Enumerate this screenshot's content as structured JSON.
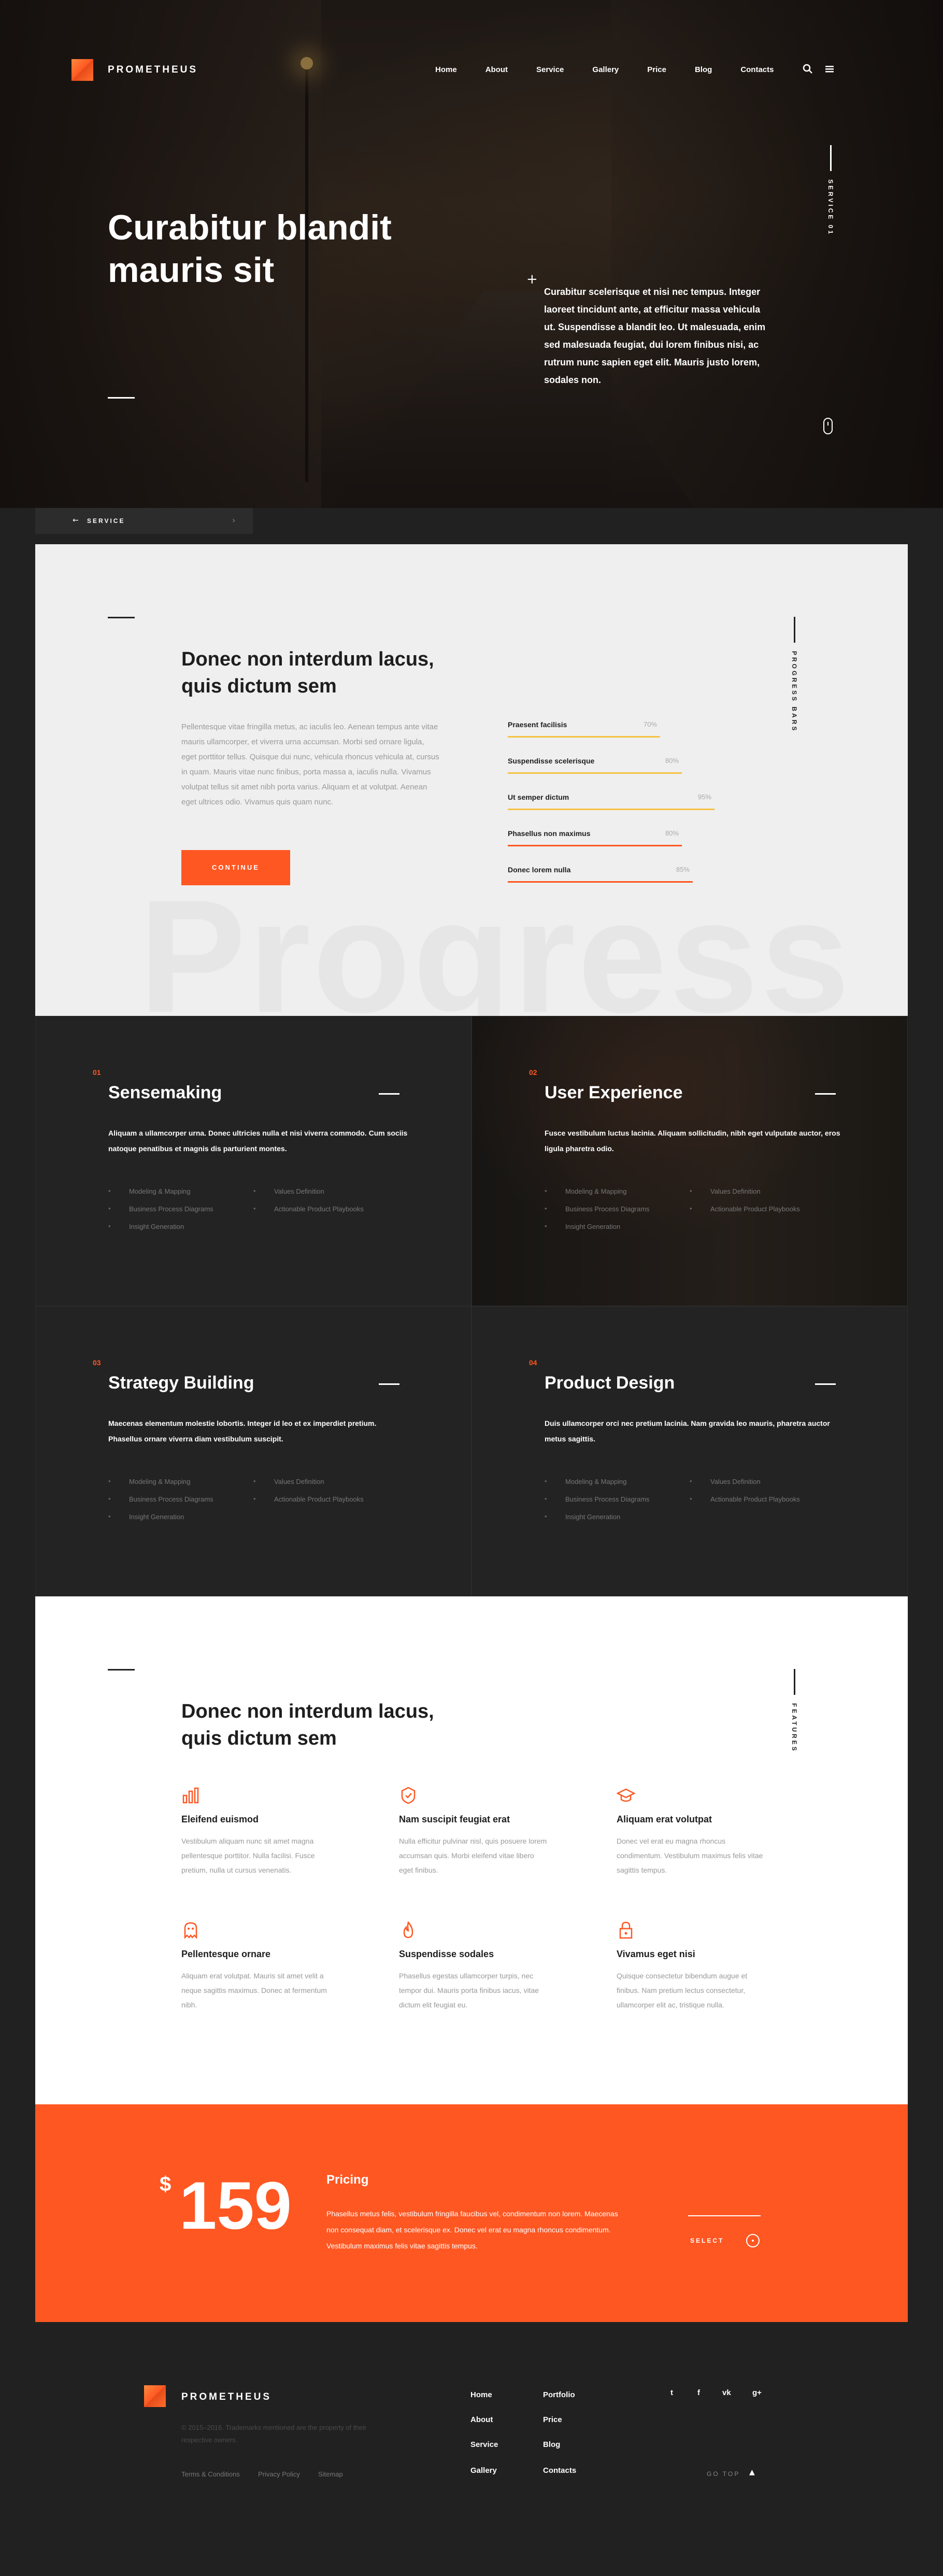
{
  "brand": {
    "name": "PROMETHEUS",
    "accent": "#ff5722"
  },
  "nav": {
    "links": [
      "Home",
      "About",
      "Service",
      "Gallery",
      "Price",
      "Blog",
      "Contacts"
    ],
    "search_icon": "search-icon",
    "menu_icon": "menu-icon"
  },
  "hero": {
    "title": "Curabitur blandit mauris sit",
    "text": "Curabitur scelerisque et nisi nec tempus. Integer laoreet tincidunt ante, at efficitur massa vehicula ut. Suspendisse a blandit leo. Ut malesuada, enim sed malesuada feugiat, dui lorem finibus nisi, ac rutrum nunc sapien eget elit. Mauris justo lorem, sodales non.",
    "side_label": "SERVICE 01"
  },
  "service_bar": {
    "label": "SERVICE"
  },
  "progress": {
    "title": "Donec non interdum lacus, quis dictum sem",
    "text": "Pellentesque vitae fringilla metus, ac iaculis leo. Aenean tempus ante vitae mauris ullamcorper, et viverra urna accumsan. Morbi sed ornare ligula, eget porttitor tellus. Quisque dui nunc, vehicula rhoncus vehicula at, cursus in quam. Mauris vitae nunc finibus, porta massa a, iaculis nulla. Vivamus volutpat tellus sit amet nibh porta varius. Aliquam et at volutpat. Aenean eget ultrices odio. Vivamus quis quam nunc.",
    "button": "CONTINUE",
    "side_label": "PROGRESS BARS",
    "bg_word": "Progress",
    "bars": [
      {
        "label": "Praesent facilisis",
        "value": 70,
        "pct": "70%",
        "color": "#f6c243"
      },
      {
        "label": "Suspendisse scelerisque",
        "value": 80,
        "pct": "80%",
        "color": "#f6c243"
      },
      {
        "label": "Ut semper dictum",
        "value": 95,
        "pct": "95%",
        "color": "#f6c243"
      },
      {
        "label": "Phasellus non maximus",
        "value": 80,
        "pct": "80%",
        "color": "#ff5722"
      },
      {
        "label": "Donec lorem nulla",
        "value": 85,
        "pct": "85%",
        "color": "#ff5722"
      }
    ]
  },
  "services": [
    {
      "num": "01",
      "title": "Sensemaking",
      "desc": "Aliquam a ullamcorper urna. Donec ultricies nulla et nisi viverra commodo. Cum sociis natoque penatibus et magnis dis parturient montes.",
      "items": [
        "Modeling & Mapping",
        "Values Definition",
        "Business Process Diagrams",
        "Actionable Product Playbooks",
        "Insight Generation"
      ]
    },
    {
      "num": "02",
      "title": "User Experience",
      "desc": "Fusce vestibulum luctus lacinia. Aliquam sollicitudin, nibh eget vulputate auctor, eros ligula pharetra odio.",
      "items": [
        "Modeling & Mapping",
        "Values Definition",
        "Business Process Diagrams",
        "Actionable Product Playbooks",
        "Insight Generation"
      ]
    },
    {
      "num": "03",
      "title": "Strategy Building",
      "desc": "Maecenas elementum molestie lobortis. Integer id leo et ex imperdiet pretium. Phasellus ornare viverra diam vestibulum suscipit.",
      "items": [
        "Modeling & Mapping",
        "Values Definition",
        "Business Process Diagrams",
        "Actionable Product Playbooks",
        "Insight Generation"
      ]
    },
    {
      "num": "04",
      "title": "Product Design",
      "desc": "Duis ullamcorper orci nec pretium lacinia. Nam gravida leo mauris, pharetra auctor metus sagittis.",
      "items": [
        "Modeling & Mapping",
        "Values Definition",
        "Business Process Diagrams",
        "Actionable Product Playbooks",
        "Insight Generation"
      ]
    }
  ],
  "features": {
    "title": "Donec non interdum lacus, quis dictum sem",
    "side_label": "FEATURES",
    "items": [
      {
        "icon": "chart-icon",
        "title": "Eleifend euismod",
        "text": "Vestibulum aliquam nunc sit amet magna pellentesque porttitor. Nulla facilisi. Fusce pretium, nulla ut cursus venenatis."
      },
      {
        "icon": "badge-icon",
        "title": "Nam suscipit feugiat erat",
        "text": "Nulla efficitur pulvinar nisl, quis posuere lorem accumsan quis. Morbi eleifend vitae libero eget finibus."
      },
      {
        "icon": "graduation-cap-icon",
        "title": "Aliquam erat volutpat",
        "text": "Donec vel erat eu magna rhoncus condimentum. Vestibulum maximus felis vitae sagittis tempus."
      },
      {
        "icon": "ghost-icon",
        "title": "Pellentesque ornare",
        "text": "Aliquam erat volutpat. Mauris sit amet velit a neque sagittis maximus. Donec at fermentum nibh."
      },
      {
        "icon": "fire-icon",
        "title": "Suspendisse sodales",
        "text": "Phasellus egestas ullamcorper turpis, nec tempor dui. Mauris porta finibus iacus, vitae dictum elit feugiat eu."
      },
      {
        "icon": "lock-icon",
        "title": "Vivamus eget nisi",
        "text": "Quisque consectetur bibendum augue et finibus. Nam pretium lectus consectetur, ullamcorper elit ac, tristique nulla."
      }
    ]
  },
  "pricing": {
    "currency": "$",
    "amount": "159",
    "title": "Pricing",
    "text": "Phasellus metus felis, vestibulum fringilla faucibus vel, condimentum non lorem. Maecenas non consequat diam, et scelerisque ex. Donec vel erat eu magna rhoncus condimentum. Vestibulum maximus felis vitae sagittis tempus.",
    "select": "SELECT"
  },
  "footer": {
    "name": "PROMETHEUS",
    "copyright": "© 2015–2016. Trademarks mentioned are the property of their respective owners.",
    "legal": [
      "Terms & Conditions",
      "Privacy Policy",
      "Sitemap"
    ],
    "col1": [
      "Home",
      "About",
      "Service",
      "Gallery"
    ],
    "col2": [
      "Portfolio",
      "Price",
      "Blog",
      "Contacts"
    ],
    "social": [
      "t",
      "f",
      "vk",
      "g+"
    ],
    "go_top": "GO TOP"
  }
}
